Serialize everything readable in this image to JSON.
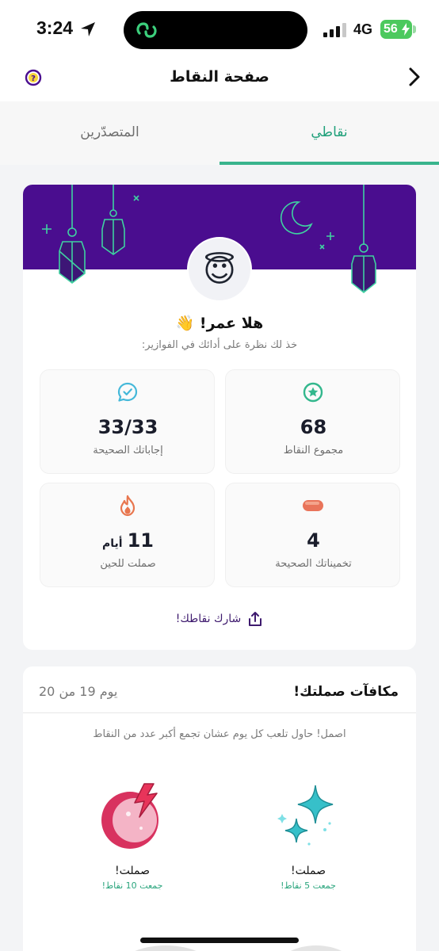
{
  "status_bar": {
    "time": "3:24",
    "network": "4G",
    "battery": "56",
    "icons": [
      "location-arrow-icon",
      "app-logo-icon",
      "signal-icon",
      "battery-charging-icon"
    ]
  },
  "header": {
    "title": "صفحة النقاط",
    "icons": [
      "help-icon",
      "chevron-right-icon"
    ]
  },
  "tabs": [
    {
      "label": "المتصدّرين",
      "active": false
    },
    {
      "label": "نقاطي",
      "active": true
    }
  ],
  "colors": {
    "accent_green": "#39b48d",
    "banner_purple": "#4a0d8f",
    "share_purple": "#3e1a6e"
  },
  "profile": {
    "avatar_emoji": "😇",
    "greeting": "هلا عمر! 👋",
    "subtitle": "خذ لك نظرة على أدائك في الفوازير:"
  },
  "stats": [
    {
      "icon": "star-badge-icon",
      "value": "68",
      "label": "مجموع النقاط"
    },
    {
      "icon": "chat-check-icon",
      "value": "33/33",
      "label": "إجاباتك الصحيحة"
    },
    {
      "icon": "date-fruit-icon",
      "value": "4",
      "label": "تخميناتك الصحيحة"
    },
    {
      "icon": "flame-icon",
      "value": "11",
      "unit": "أيام",
      "label": "صملت للحين"
    }
  ],
  "share": {
    "label": "شارك نقاطك!",
    "icon": "share-icon"
  },
  "rewards": {
    "title": "مكافآت صملتك!",
    "day_count": "يوم 19 من 20",
    "description": "اصمل! حاول تلعب كل يوم عشان تجمع أكبر عدد من النقاط",
    "items": [
      {
        "icon": "sparkles-icon",
        "title": "صملت!",
        "subtitle": "جمعت 5 نقاط!"
      },
      {
        "icon": "moon-lightning-icon",
        "title": "صملت!",
        "subtitle": "جمعت 10 نقاط!"
      }
    ]
  }
}
